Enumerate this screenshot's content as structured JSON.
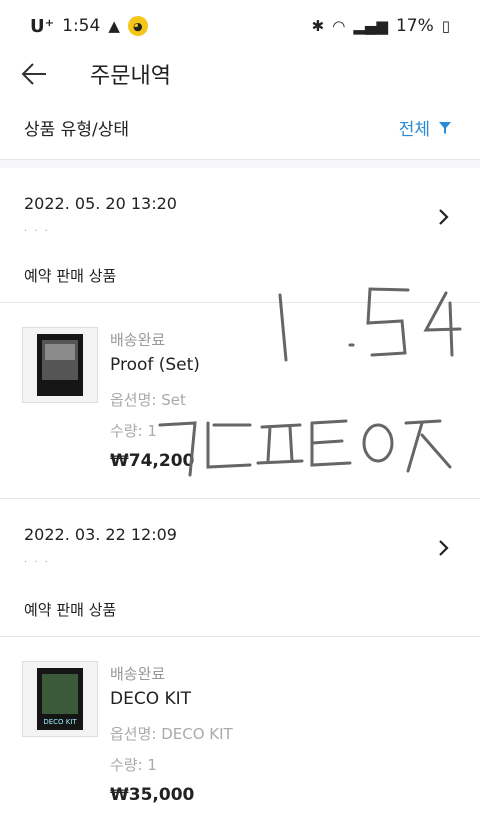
{
  "status_bar": {
    "carrier": "U⁺",
    "time": "1:54",
    "battery": "17%"
  },
  "header": {
    "title": "주문내역"
  },
  "filter": {
    "label": "상품 유형/상태",
    "value": "전체"
  },
  "orders": [
    {
      "date": "2022. 05. 20 13:20",
      "subtext": "· · ·",
      "type": "예약 판매 상품",
      "item": {
        "status": "배송완료",
        "name": "Proof (Set)",
        "option": "옵션명: Set",
        "qty": "수량: 1",
        "price": "₩74,200"
      }
    },
    {
      "date": "2022. 03. 22 12:09",
      "subtext": "· · ·",
      "type": "예약 판매 상품",
      "item": {
        "status": "배송완료",
        "name": "DECO KIT",
        "option": "옵션명: DECO KIT",
        "qty": "수량: 1",
        "price": "₩35,000",
        "box_text": "DECO KIT"
      }
    }
  ],
  "colors": {
    "accent": "#2a8ad6",
    "divider": "#e6e6ee"
  }
}
